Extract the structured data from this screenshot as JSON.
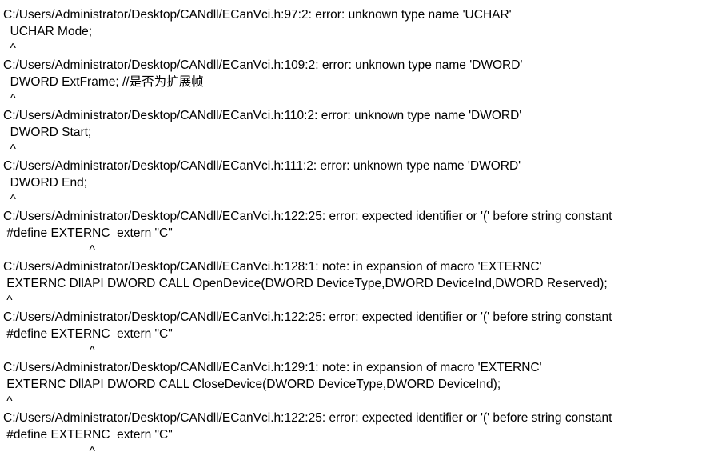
{
  "output_lines": [
    "C:/Users/Administrator/Desktop/CANdll/ECanVci.h:97:2: error: unknown type name 'UCHAR'",
    "  UCHAR Mode;",
    "  ^",
    "C:/Users/Administrator/Desktop/CANdll/ECanVci.h:109:2: error: unknown type name 'DWORD'",
    "  DWORD ExtFrame; //是否为扩展帧",
    "  ^",
    "C:/Users/Administrator/Desktop/CANdll/ECanVci.h:110:2: error: unknown type name 'DWORD'",
    "  DWORD Start;",
    "  ^",
    "C:/Users/Administrator/Desktop/CANdll/ECanVci.h:111:2: error: unknown type name 'DWORD'",
    "  DWORD End;",
    "  ^",
    "C:/Users/Administrator/Desktop/CANdll/ECanVci.h:122:25: error: expected identifier or '(' before string constant",
    " #define EXTERNC  extern \"C\"",
    "                         ^",
    "C:/Users/Administrator/Desktop/CANdll/ECanVci.h:128:1: note: in expansion of macro 'EXTERNC'",
    " EXTERNC DllAPI DWORD CALL OpenDevice(DWORD DeviceType,DWORD DeviceInd,DWORD Reserved);",
    " ^",
    "C:/Users/Administrator/Desktop/CANdll/ECanVci.h:122:25: error: expected identifier or '(' before string constant",
    " #define EXTERNC  extern \"C\"",
    "                         ^",
    "C:/Users/Administrator/Desktop/CANdll/ECanVci.h:129:1: note: in expansion of macro 'EXTERNC'",
    " EXTERNC DllAPI DWORD CALL CloseDevice(DWORD DeviceType,DWORD DeviceInd);",
    " ^",
    "C:/Users/Administrator/Desktop/CANdll/ECanVci.h:122:25: error: expected identifier or '(' before string constant",
    " #define EXTERNC  extern \"C\"",
    "                         ^"
  ]
}
